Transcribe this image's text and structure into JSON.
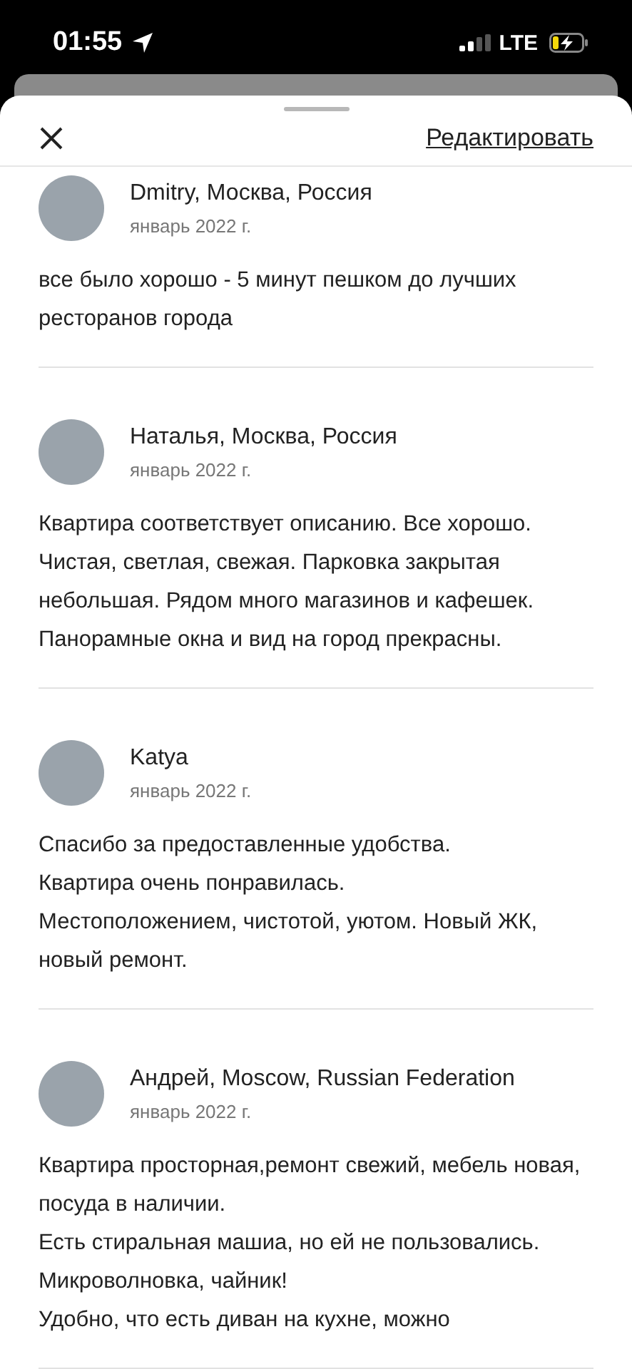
{
  "status_bar": {
    "time": "01:55",
    "network": "LTE"
  },
  "header": {
    "edit_link": "Редактировать"
  },
  "reviews": [
    {
      "name": "Dmitry, Москва, Россия",
      "date": "январь 2022 г.",
      "text": "все было хорошо - 5 минут пешком до лучших ресторанов города"
    },
    {
      "name": "Наталья, Москва, Россия",
      "date": "январь 2022 г.",
      "text": "Квартира соответствует описанию. Все хорошо. Чистая, светлая, свежая. Парковка закрытая небольшая. Рядом много магазинов и кафешек. Панорамные окна и вид на город прекрасны."
    },
    {
      "name": "Katya",
      "date": "январь 2022 г.",
      "text": "Спасибо за предоставленные удобства.\nКвартира очень понравилась.\nМестоположением, чистотой, уютом. Новый ЖК, новый ремонт."
    },
    {
      "name": "Андрей, Moscow, Russian Federation",
      "date": "январь 2022 г.",
      "text": "Квартира просторная,ремонт свежий, мебель новая, посуда в наличии.\nЕсть стиральная машиа, но ей не пользовались.\nМикроволновка, чайник!\nУдобно, что есть диван на кухне, можно"
    }
  ]
}
